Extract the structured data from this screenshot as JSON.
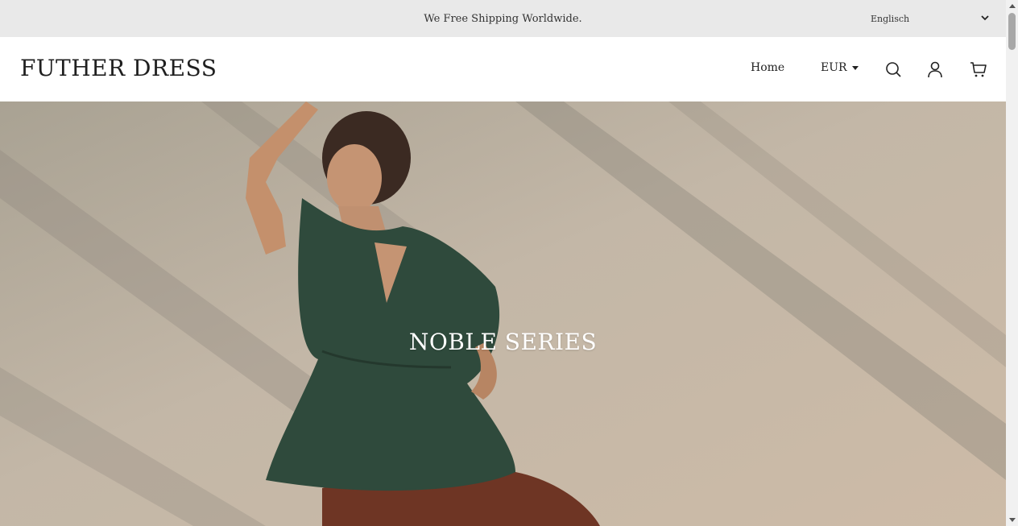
{
  "announcement": {
    "text": "We Free Shipping Worldwide.",
    "language": "Englisch"
  },
  "header": {
    "logo": "FUTHER DRESS",
    "nav": [
      {
        "label": "Home"
      }
    ],
    "currency": "EUR",
    "icons": [
      "search-icon",
      "account-icon",
      "cart-icon"
    ]
  },
  "hero": {
    "title": "NOBLE SERIES"
  },
  "colors": {
    "announcement_bg": "#e9e9e9",
    "hero_text": "#ffffff",
    "shirt_green": "#2f4a3c",
    "wall_beige": "#c1b5a5"
  }
}
